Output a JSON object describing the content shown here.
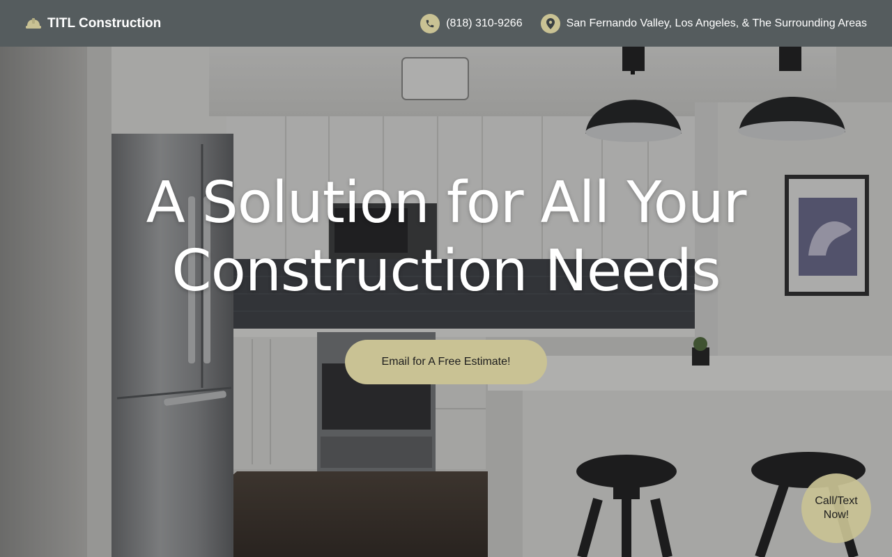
{
  "header": {
    "brand_name": "TITL Construction",
    "brand_icon": "hard-hat-icon",
    "phone": "(818) 310-9266",
    "phone_icon": "phone-icon",
    "location": "San Fernando Valley, Los Angeles, & The Surrounding Areas",
    "location_icon": "map-pin-icon"
  },
  "hero": {
    "headline_line1": "A Solution for All Your",
    "headline_line2": "Construction Needs",
    "cta_label": "Email for A Free Estimate!"
  },
  "floating": {
    "call_label": "Call/Text Now!"
  },
  "colors": {
    "header_bg": "#555c5e",
    "accent": "#c9c294",
    "text_light": "#ffffff",
    "text_dark": "#1d1d1d"
  }
}
